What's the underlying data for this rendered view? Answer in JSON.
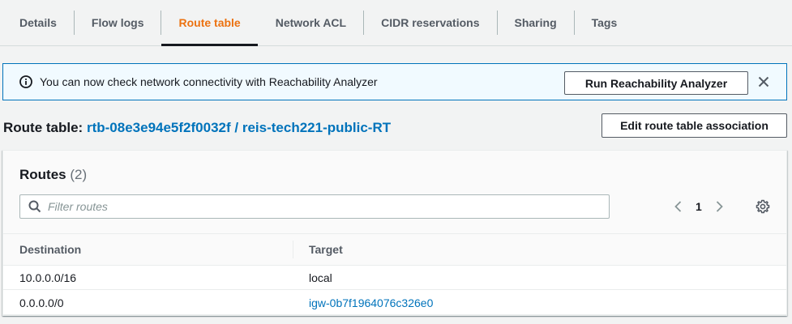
{
  "tabs": [
    {
      "label": "Details"
    },
    {
      "label": "Flow logs"
    },
    {
      "label": "Route table",
      "active": true
    },
    {
      "label": "Network ACL"
    },
    {
      "label": "CIDR reservations"
    },
    {
      "label": "Sharing"
    },
    {
      "label": "Tags"
    }
  ],
  "banner": {
    "icon": "info-icon",
    "text": "You can now check network connectivity with Reachability Analyzer",
    "button_label": "Run Reachability Analyzer",
    "close_icon": "close-icon"
  },
  "route_table": {
    "label": "Route table:",
    "id": "rtb-08e3e94e5f2f0032f",
    "separator": "/",
    "name": "reis-tech221-public-RT",
    "edit_button_label": "Edit route table association"
  },
  "routes": {
    "title": "Routes",
    "count": "(2)",
    "filter_placeholder": "Filter routes",
    "filter_value": "",
    "current_page": "1",
    "columns": [
      "Destination",
      "Target"
    ],
    "rows": [
      {
        "destination": "10.0.0.0/16",
        "target": "local"
      },
      {
        "destination": "0.0.0.0/0",
        "target": "igw-0b7f1964076c326e0"
      }
    ]
  },
  "colors": {
    "active_tab": "#ec7211",
    "link": "#0073bb",
    "banner_border": "#0073bb",
    "banner_bg": "#f1faff"
  }
}
